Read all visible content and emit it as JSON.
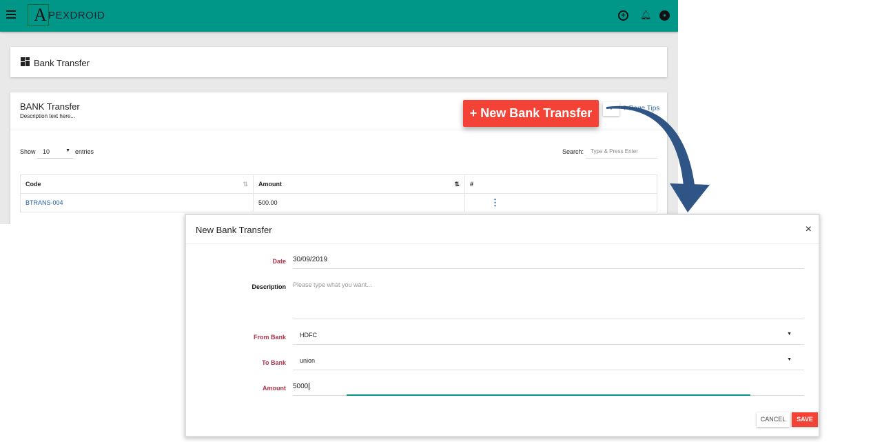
{
  "header": {
    "logo_letter": "A",
    "logo_text": "PEXDROID",
    "brand_color": "#009688"
  },
  "breadcrumb": {
    "title": "Bank Transfer"
  },
  "panel": {
    "title": "BANK Transfer",
    "description": "Description text here...",
    "page_tips": "Page Tips",
    "new_button": "+ New Bank Transfer",
    "show_label": "Show",
    "entries_value": "10",
    "entries_label": "entries",
    "search_label": "Search:",
    "search_placeholder": "Type & Press Enter",
    "columns": [
      "Code",
      "Amount",
      "#"
    ],
    "rows": [
      {
        "code": "BTRANS-004",
        "amount": "500.00"
      }
    ]
  },
  "modal": {
    "title": "New Bank Transfer",
    "close": "×",
    "date_label": "Date",
    "date_value": "30/09/2019",
    "description_label": "Description",
    "description_placeholder": "Please type what you want...",
    "from_label": "From Bank",
    "from_value": "HDFC",
    "to_label": "To Bank",
    "to_value": "union",
    "amount_label": "Amount",
    "amount_value": "5000",
    "cancel": "CANCEL",
    "save": "SAVE",
    "accent_color": "#f44336"
  }
}
